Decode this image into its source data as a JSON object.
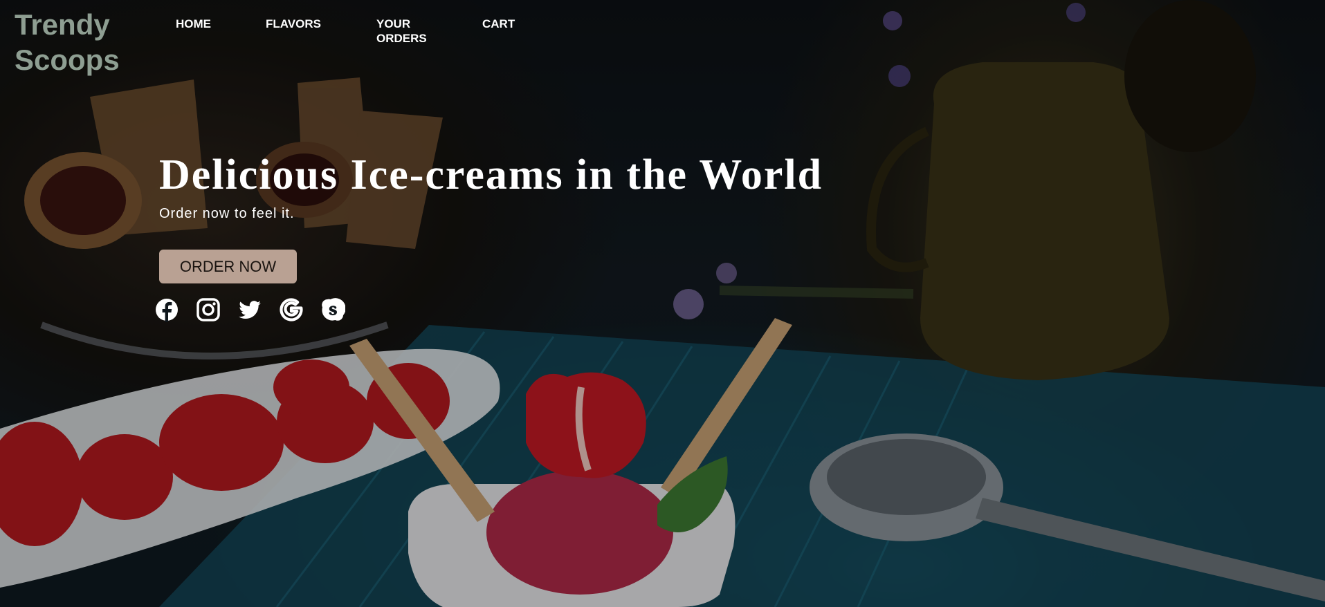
{
  "brand": {
    "logo_text": "Trendy\nScoops",
    "logo_color": "#8e9e92"
  },
  "nav": {
    "home": "HOME",
    "flavors": "FLAVORS",
    "orders": "YOUR\nORDERS",
    "cart": "CART"
  },
  "hero": {
    "title": "Delicious Ice-creams in the World",
    "subtitle": "Order now to feel it.",
    "cta_label": "ORDER NOW",
    "cta_color": "#b9a193"
  },
  "socials": [
    {
      "icon": "facebook-icon"
    },
    {
      "icon": "instagram-icon"
    },
    {
      "icon": "twitter-icon"
    },
    {
      "icon": "google-icon"
    },
    {
      "icon": "skype-icon"
    }
  ]
}
